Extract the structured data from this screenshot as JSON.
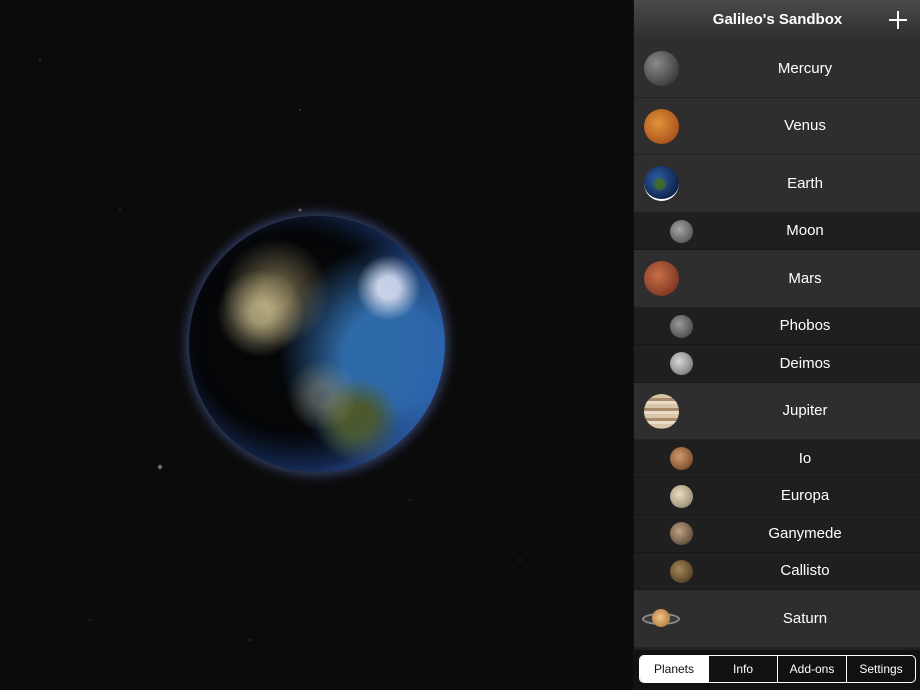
{
  "header": {
    "title": "Galileo's Sandbox",
    "add_icon": "plus-icon"
  },
  "bodies": [
    {
      "name": "Mercury",
      "kind": "planet",
      "icon": "mercury-thumbnail"
    },
    {
      "name": "Venus",
      "kind": "planet",
      "icon": "venus-thumbnail"
    },
    {
      "name": "Earth",
      "kind": "planet",
      "icon": "earth-thumbnail",
      "selected": true
    },
    {
      "name": "Moon",
      "kind": "moon",
      "icon": "moon-thumbnail"
    },
    {
      "name": "Mars",
      "kind": "planet",
      "icon": "mars-thumbnail"
    },
    {
      "name": "Phobos",
      "kind": "moon",
      "icon": "phobos-thumbnail"
    },
    {
      "name": "Deimos",
      "kind": "moon",
      "icon": "deimos-thumbnail"
    },
    {
      "name": "Jupiter",
      "kind": "planet",
      "icon": "jupiter-thumbnail"
    },
    {
      "name": "Io",
      "kind": "moon",
      "icon": "io-thumbnail"
    },
    {
      "name": "Europa",
      "kind": "moon",
      "icon": "europa-thumbnail"
    },
    {
      "name": "Ganymede",
      "kind": "moon",
      "icon": "ganymede-thumbnail"
    },
    {
      "name": "Callisto",
      "kind": "moon",
      "icon": "callisto-thumbnail"
    },
    {
      "name": "Saturn",
      "kind": "planet",
      "icon": "saturn-thumbnail"
    }
  ],
  "tabs": [
    {
      "label": "Planets",
      "active": true
    },
    {
      "label": "Info",
      "active": false
    },
    {
      "label": "Add-ons",
      "active": false
    },
    {
      "label": "Settings",
      "active": false
    }
  ],
  "viewer": {
    "body": "Earth"
  }
}
